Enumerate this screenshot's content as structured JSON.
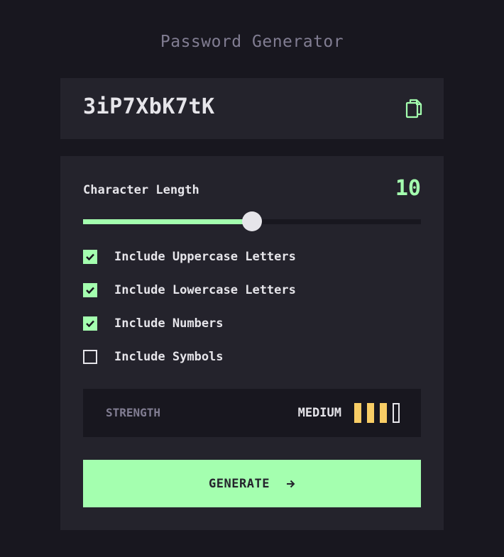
{
  "title": "Password Generator",
  "password": "3iP7XbK7tK",
  "length": {
    "label": "Character Length",
    "value": "10",
    "fraction": 0.5
  },
  "options": [
    {
      "label": "Include Uppercase Letters",
      "checked": true
    },
    {
      "label": "Include Lowercase Letters",
      "checked": true
    },
    {
      "label": "Include Numbers",
      "checked": true
    },
    {
      "label": "Include Symbols",
      "checked": false
    }
  ],
  "strength": {
    "label": "STRENGTH",
    "value": "MEDIUM",
    "bars_total": 4,
    "bars_filled": 3
  },
  "generate": {
    "label": "GENERATE"
  },
  "icons": {
    "copy": "copy-icon",
    "arrow": "arrow-right-icon",
    "check": "check-icon"
  },
  "colors": {
    "background": "#18171f",
    "card": "#24232c",
    "accent": "#a4ffaf",
    "muted": "#817d92",
    "text": "#e6e5ea",
    "strength_medium": "#f8cd65"
  }
}
